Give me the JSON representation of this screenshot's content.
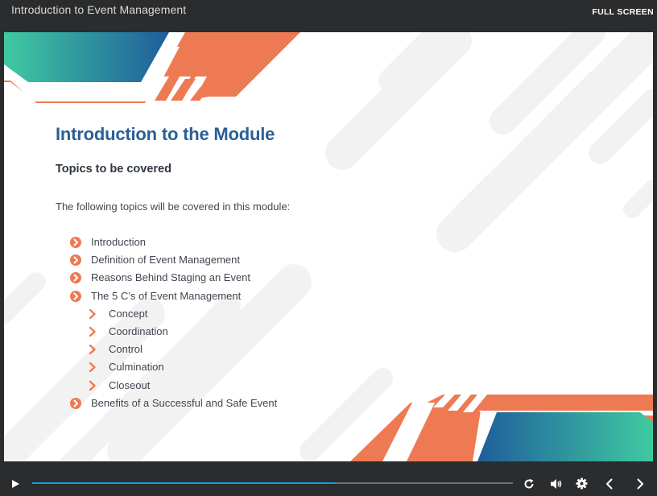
{
  "window": {
    "title": "Introduction to Event Management",
    "fullscreen_label": "FULL SCREEN"
  },
  "slide": {
    "heading": "Introduction to the Module",
    "subheading": "Topics to be covered",
    "intro": "The following topics will be covered in this module:",
    "topics": [
      {
        "label": "Introduction",
        "level": 1
      },
      {
        "label": "Definition of Event Management",
        "level": 1
      },
      {
        "label": "Reasons Behind Staging an Event",
        "level": 1
      },
      {
        "label": "The 5 C’s of Event Management",
        "level": 1
      },
      {
        "label": "Concept",
        "level": 2
      },
      {
        "label": "Coordination",
        "level": 2
      },
      {
        "label": "Control",
        "level": 2
      },
      {
        "label": "Culmination",
        "level": 2
      },
      {
        "label": "Closeout",
        "level": 2
      },
      {
        "label": "Benefits of a Successful and Safe Event",
        "level": 1
      }
    ],
    "colors": {
      "heading": "#2a5f96",
      "accent_orange": "#ee7a53",
      "gradient_teal": "#3fcaa0",
      "gradient_blue": "#1f5d9c"
    }
  },
  "player": {
    "progress_fraction": 0.63,
    "progress_color": "#1d9bd7",
    "buttons": [
      "play-icon",
      "replay-icon",
      "volume-icon",
      "settings-gear-icon",
      "previous-arrow-icon",
      "next-arrow-icon"
    ]
  }
}
